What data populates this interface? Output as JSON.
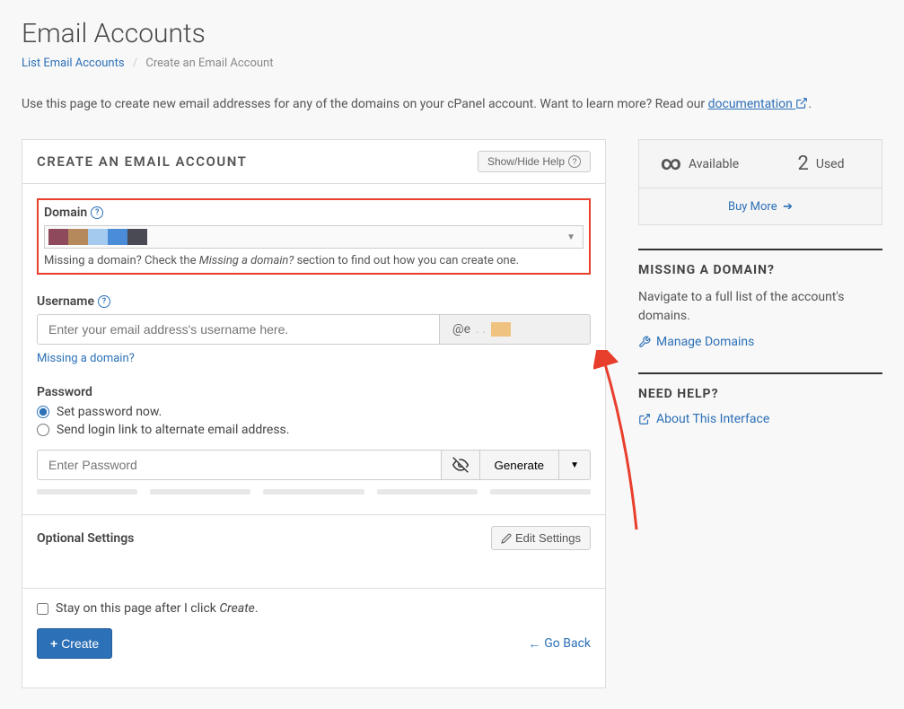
{
  "page": {
    "title": "Email Accounts",
    "breadcrumb_link": "List Email Accounts",
    "breadcrumb_current": "Create an Email Account",
    "intro_text": "Use this page to create new email addresses for any of the domains on your cPanel account. Want to learn more? Read our ",
    "doc_link": "documentation",
    "intro_end": "."
  },
  "panel": {
    "title": "CREATE AN EMAIL ACCOUNT",
    "help_btn": "Show/Hide Help"
  },
  "domain": {
    "label": "Domain",
    "hint_pre": "Missing a domain? Check the ",
    "hint_em": "Missing a domain?",
    "hint_post": " section to find out how you can create one."
  },
  "username": {
    "label": "Username",
    "placeholder": "Enter your email address's username here.",
    "addon": "@e",
    "missing_link": "Missing a domain?"
  },
  "password": {
    "label": "Password",
    "radio_now": "Set password now.",
    "radio_send": "Send login link to alternate email address.",
    "placeholder": "Enter Password",
    "generate": "Generate"
  },
  "optional": {
    "title": "Optional Settings",
    "edit": "Edit Settings"
  },
  "footer": {
    "stay_pre": "Stay on this page after I click ",
    "stay_em": "Create",
    "stay_post": ".",
    "create": "Create",
    "goback": "Go Back"
  },
  "stats": {
    "available": "Available",
    "used_num": "2",
    "used": "Used",
    "buy": "Buy More"
  },
  "missing_domain": {
    "title": "MISSING A DOMAIN?",
    "text": "Navigate to a full list of the account's domains.",
    "link": "Manage Domains"
  },
  "help": {
    "title": "NEED HELP?",
    "link": "About This Interface"
  }
}
